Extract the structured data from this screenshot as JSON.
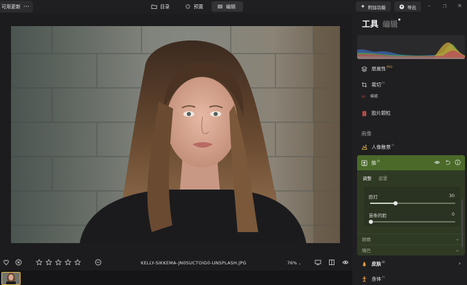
{
  "topbar": {
    "update_label": "可用更新",
    "nav": [
      {
        "label": "目录",
        "icon": "folder-icon"
      },
      {
        "label": "预置",
        "icon": "presets-icon"
      },
      {
        "label": "编辑",
        "icon": "sliders-icon"
      }
    ],
    "addons_label": "附加功能",
    "export_label": "导出"
  },
  "image": {
    "filename": "KELLY-SIKKEMA-JN0SUCTOIG0-UNSPLASH.JPG",
    "zoom": "76%"
  },
  "rating_stars": 0,
  "panel": {
    "title_tools": "工具",
    "title_edits": "编辑",
    "tools": [
      {
        "label": "层属性",
        "badge": "PRO",
        "icon": "layers-icon"
      },
      {
        "label": "裁切",
        "badge": "AI",
        "icon": "crop-icon"
      },
      {
        "label": "模糊",
        "badge": "",
        "icon": "blur-icon"
      },
      {
        "label": "胶片颗粒",
        "badge": "",
        "icon": "film-grain-icon"
      }
    ],
    "section_image": "画像",
    "portrait_bg": {
      "label": "人像散景",
      "badge": "AI"
    },
    "face": {
      "label": "脸",
      "badge": "AI",
      "tabs": [
        "调整",
        "遮罩"
      ],
      "sliders": [
        {
          "label": "脸灯",
          "value": "30",
          "level": 0.3
        },
        {
          "label": "苗条的脸",
          "value": "0",
          "level": 0.0
        }
      ],
      "collapsed": [
        "眼睛",
        "嘴巴"
      ]
    },
    "skin": {
      "label": "皮肤",
      "badge": "AI"
    },
    "body": {
      "label": "身体",
      "badge": "AI"
    }
  },
  "colors": {
    "accent_green": "#4b6a2a",
    "card_green": "#2f3a24",
    "thumb_border": "#e5b94a"
  }
}
